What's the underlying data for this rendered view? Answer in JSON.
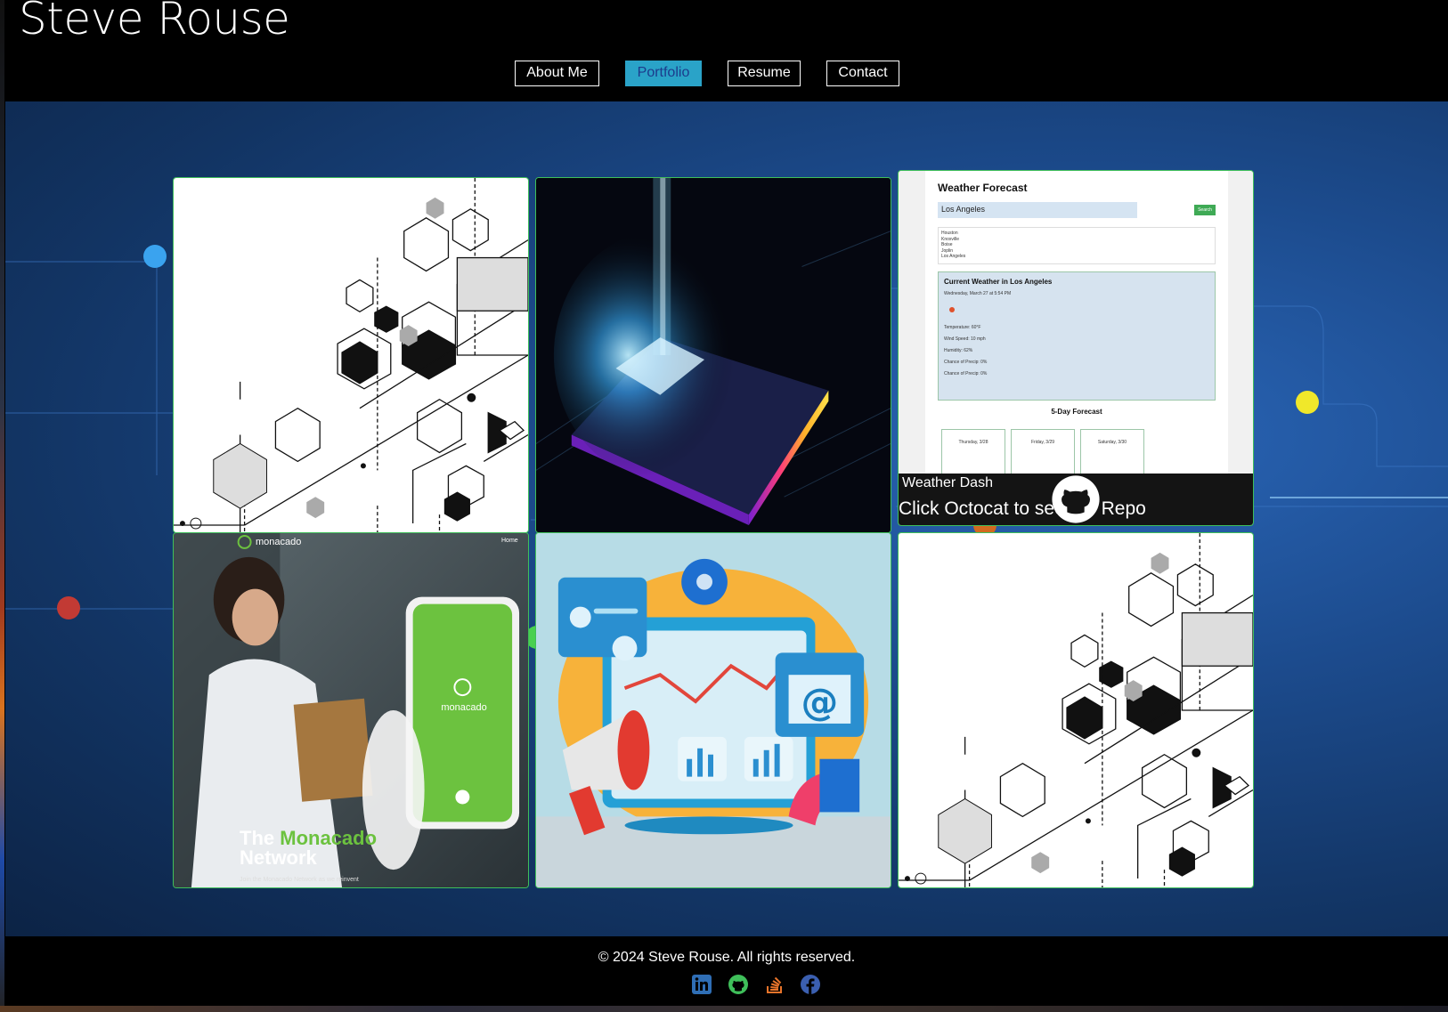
{
  "header": {
    "title": "Steve Rouse"
  },
  "nav": {
    "items": [
      {
        "label": "About Me",
        "active": false
      },
      {
        "label": "Portfolio",
        "active": true
      },
      {
        "label": "Resume",
        "active": false
      },
      {
        "label": "Contact",
        "active": false
      }
    ]
  },
  "portfolio": {
    "tiles": [
      {
        "image": "circuit-hexagon-illustration"
      },
      {
        "image": "glowing-processor-chip"
      },
      {
        "image": "weather-dashboard-screenshot",
        "caption_title": "Weather Dash",
        "caption_link": "Click Octocat to see the Repo",
        "caption_icon": "github-octocat-icon",
        "screenshot": {
          "app_title": "Weather Forecast",
          "search_value": "Los Angeles",
          "search_button": "Search",
          "history": [
            "Houston",
            "Knoxville",
            "Boise",
            "Joplin",
            "Los Angeles"
          ],
          "current_heading": "Current Weather in Los Angeles",
          "current_date": "Wednesday, March 27 at 5:54 PM",
          "temperature": "Temperature: 60°F",
          "wind": "Wind Speed: 10 mph",
          "humidity": "Humidity: 62%",
          "precip1": "Chance of Precip: 0%",
          "precip2": "Chance of Precip: 0%",
          "forecast_heading": "5-Day Forecast",
          "forecast_days": [
            "Thursday, 3/28",
            "Friday, 3/29",
            "Saturday, 3/30"
          ]
        }
      },
      {
        "image": "monacado-app-promo",
        "brand": "monacado",
        "nav_link": "Home",
        "phone_brand": "monacado",
        "headline_prefix": "The",
        "headline_brand": "Monacado",
        "headline_suffix": "Network",
        "tagline": "Join the Monacado Network as we reinvent"
      },
      {
        "image": "digital-marketing-3d-illustration"
      },
      {
        "image": "circuit-hexagon-illustration"
      }
    ]
  },
  "footer": {
    "copyright": "© 2024 Steve Rouse. All rights reserved.",
    "social": [
      {
        "icon": "linkedin-icon",
        "color": "#2f6eb5"
      },
      {
        "icon": "github-icon",
        "color": "#3fbf5a"
      },
      {
        "icon": "stackoverflow-icon",
        "color": "#e8742a"
      },
      {
        "icon": "facebook-icon",
        "color": "#3b5fb0"
      }
    ]
  },
  "colors": {
    "nav_active_bg": "#2aa3c8",
    "nav_active_text": "#1c3b8c",
    "tile_border": "#3fbf5a",
    "monacado_green": "#6cc23f"
  }
}
